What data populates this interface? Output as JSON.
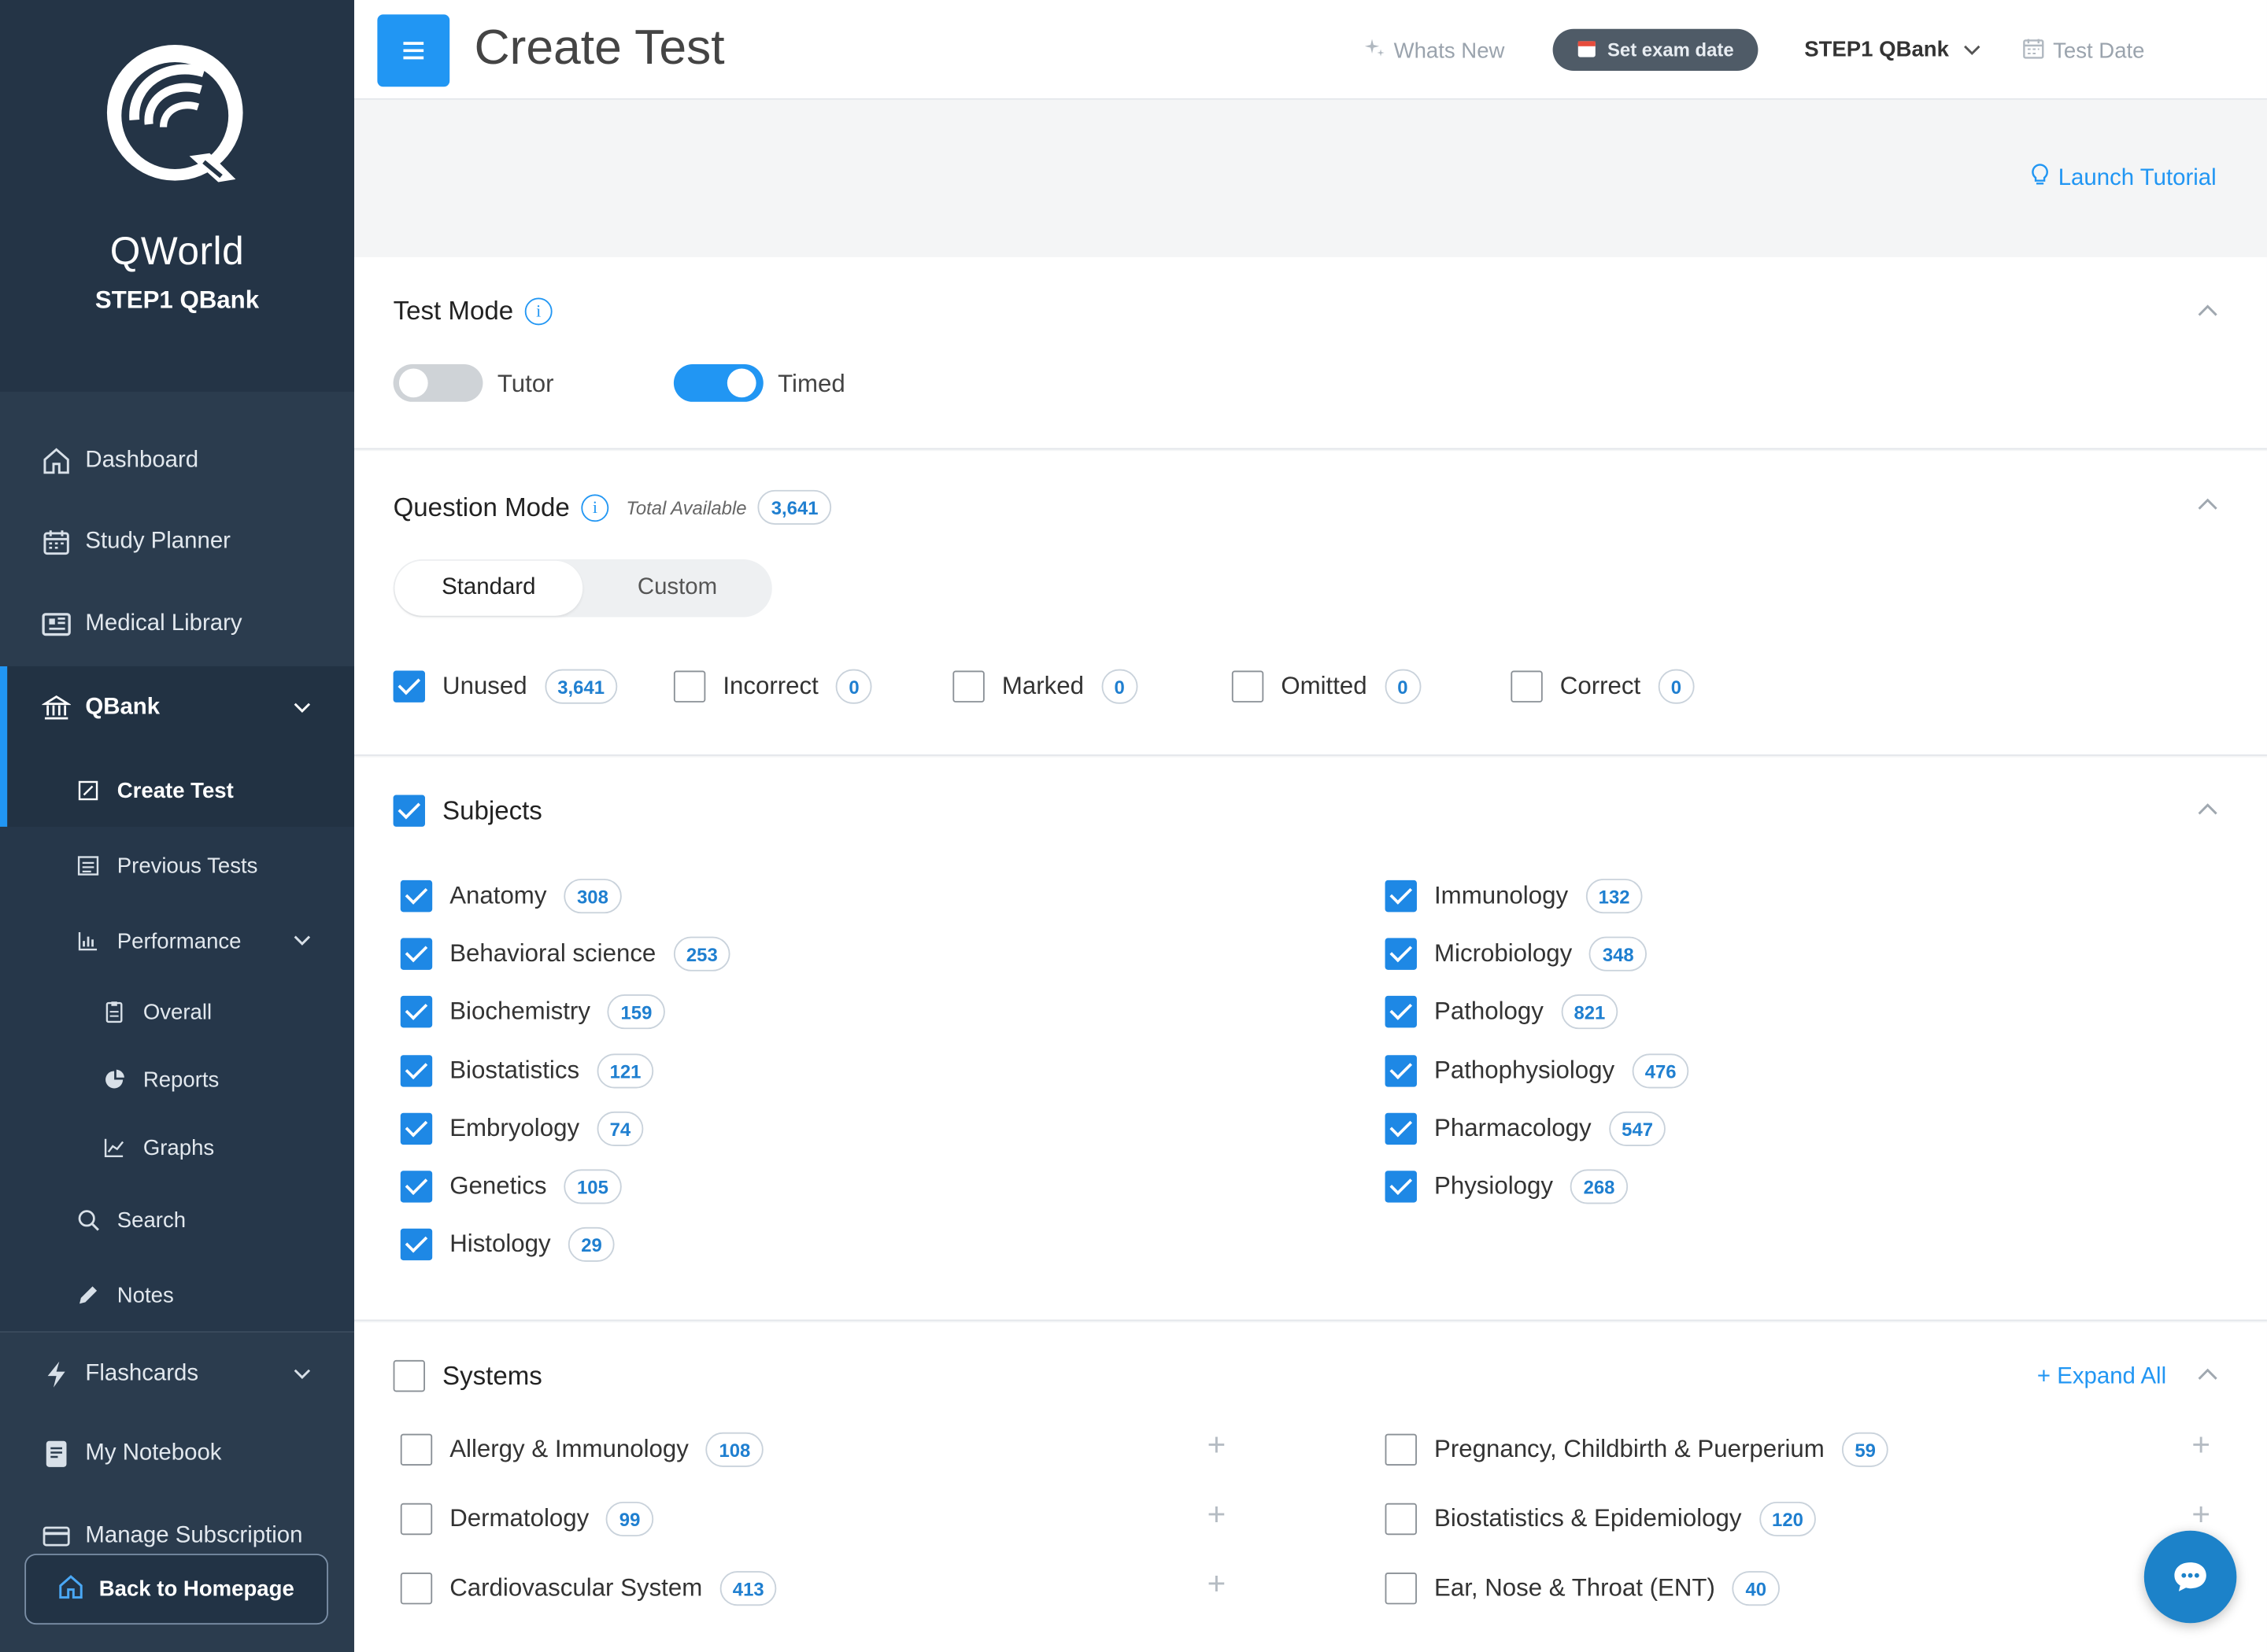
{
  "brand": {
    "name": "QWorld",
    "subtitle": "STEP1 QBank"
  },
  "sidebar": {
    "items": [
      {
        "label": "Dashboard",
        "icon": "home-icon"
      },
      {
        "label": "Study Planner",
        "icon": "calendar-icon"
      },
      {
        "label": "Medical Library",
        "icon": "library-icon"
      },
      {
        "label": "QBank",
        "icon": "bank-icon"
      },
      {
        "label": "Create Test",
        "icon": "edit-icon"
      },
      {
        "label": "Previous Tests",
        "icon": "list-icon"
      },
      {
        "label": "Performance",
        "icon": "bar-chart-icon"
      },
      {
        "label": "Overall",
        "icon": "clipboard-icon"
      },
      {
        "label": "Reports",
        "icon": "pie-icon"
      },
      {
        "label": "Graphs",
        "icon": "line-chart-icon"
      },
      {
        "label": "Search",
        "icon": "search-icon"
      },
      {
        "label": "Notes",
        "icon": "pencil-icon"
      },
      {
        "label": "Flashcards",
        "icon": "bolt-icon"
      },
      {
        "label": "My Notebook",
        "icon": "notebook-icon"
      },
      {
        "label": "Manage Subscription",
        "icon": "card-icon"
      }
    ],
    "back_label": "Back to Homepage"
  },
  "header": {
    "title": "Create Test",
    "whats_new": "Whats New",
    "exam_btn": "Set exam date",
    "bank": "STEP1 QBank",
    "test_date": "Test Date"
  },
  "tutorial": "Launch Tutorial",
  "test_mode": {
    "title": "Test Mode",
    "tutor": "Tutor",
    "timed": "Timed",
    "tutor_on": false,
    "timed_on": true
  },
  "question_mode": {
    "title": "Question Mode",
    "total_label": "Total Available",
    "total": "3,641",
    "tabs": [
      "Standard",
      "Custom"
    ],
    "filters": [
      {
        "label": "Unused",
        "count": "3,641",
        "checked": true
      },
      {
        "label": "Incorrect",
        "count": "0",
        "checked": false
      },
      {
        "label": "Marked",
        "count": "0",
        "checked": false
      },
      {
        "label": "Omitted",
        "count": "0",
        "checked": false
      },
      {
        "label": "Correct",
        "count": "0",
        "checked": false
      }
    ]
  },
  "subjects": {
    "title": "Subjects",
    "left": [
      {
        "label": "Anatomy",
        "count": "308"
      },
      {
        "label": "Behavioral science",
        "count": "253"
      },
      {
        "label": "Biochemistry",
        "count": "159"
      },
      {
        "label": "Biostatistics",
        "count": "121"
      },
      {
        "label": "Embryology",
        "count": "74"
      },
      {
        "label": "Genetics",
        "count": "105"
      },
      {
        "label": "Histology",
        "count": "29"
      }
    ],
    "right": [
      {
        "label": "Immunology",
        "count": "132"
      },
      {
        "label": "Microbiology",
        "count": "348"
      },
      {
        "label": "Pathology",
        "count": "821"
      },
      {
        "label": "Pathophysiology",
        "count": "476"
      },
      {
        "label": "Pharmacology",
        "count": "547"
      },
      {
        "label": "Physiology",
        "count": "268"
      }
    ]
  },
  "systems": {
    "title": "Systems",
    "expand_all": "+ Expand All",
    "left": [
      {
        "label": "Allergy & Immunology",
        "count": "108"
      },
      {
        "label": "Dermatology",
        "count": "99"
      },
      {
        "label": "Cardiovascular System",
        "count": "413"
      }
    ],
    "right": [
      {
        "label": "Pregnancy, Childbirth & Puerperium",
        "count": "59"
      },
      {
        "label": "Biostatistics & Epidemiology",
        "count": "120"
      },
      {
        "label": "Ear, Nose & Throat (ENT)",
        "count": "40"
      }
    ]
  },
  "colors": {
    "accent": "#2196f3",
    "sidebar": "#2b3c4e",
    "toggle_off": "#cfd3d7"
  }
}
